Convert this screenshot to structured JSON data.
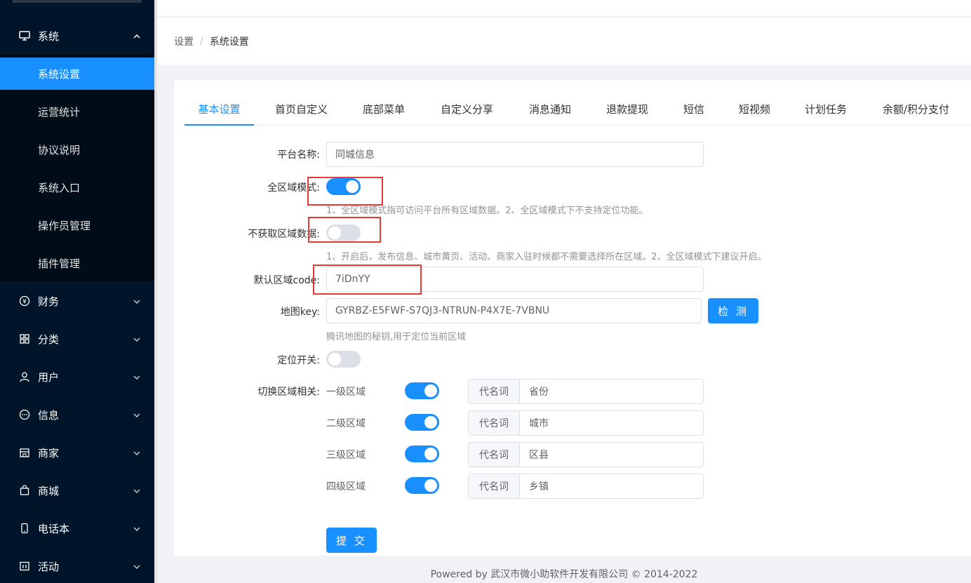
{
  "sidebar": {
    "system": {
      "label": "系统",
      "icon": "monitor-icon",
      "expanded": true
    },
    "sub_items": [
      {
        "label": "系统设置",
        "active": true
      },
      {
        "label": "运营统计"
      },
      {
        "label": "协议说明"
      },
      {
        "label": "系统入口"
      },
      {
        "label": "操作员管理"
      },
      {
        "label": "插件管理"
      }
    ],
    "groups": [
      {
        "label": "财务",
        "icon": "yen-icon"
      },
      {
        "label": "分类",
        "icon": "grid-icon"
      },
      {
        "label": "用户",
        "icon": "user-icon"
      },
      {
        "label": "信息",
        "icon": "chat-icon"
      },
      {
        "label": "商家",
        "icon": "store-icon"
      },
      {
        "label": "商城",
        "icon": "bag-icon"
      },
      {
        "label": "电话本",
        "icon": "phone-icon"
      },
      {
        "label": "活动",
        "icon": "calendar-icon"
      }
    ]
  },
  "breadcrumb": {
    "root": "设置",
    "separator": "/",
    "current": "系统设置"
  },
  "tabs": [
    {
      "label": "基本设置",
      "active": true
    },
    {
      "label": "首页自定义"
    },
    {
      "label": "底部菜单"
    },
    {
      "label": "自定义分享"
    },
    {
      "label": "消息通知"
    },
    {
      "label": "退款提现"
    },
    {
      "label": "短信"
    },
    {
      "label": "短视频"
    },
    {
      "label": "计划任务"
    },
    {
      "label": "余额/积分支付"
    }
  ],
  "form": {
    "platform_name": {
      "label": "平台名称:",
      "value": "同城信息"
    },
    "full_region": {
      "label": "全区域模式:",
      "on": true,
      "hint": "1、全区域模式指可访问平台所有区域数据。2、全区域模式下不支持定位功能。"
    },
    "no_region_data": {
      "label": "不获取区域数据:",
      "on": false,
      "hint": "1、开启后，发布信息、城市黄页、活动、商家入驻时候都不需要选择所在区域。2、全区域模式下建议开启。"
    },
    "default_region_code": {
      "label": "默认区域code:",
      "value": "7iDnYY"
    },
    "map_key": {
      "label": "地图key:",
      "value": "GYRBZ-E5FWF-S7QJ3-NTRUN-P4X7E-7VBNU",
      "button": "检 测",
      "hint": "腾讯地图的秘钥,用于定位当前区域"
    },
    "locate": {
      "label": "定位开关:",
      "on": false
    },
    "switch_region": {
      "label": "切换区域相关:",
      "alias_prefix": "代名词",
      "levels": [
        {
          "label": "一级区域",
          "on": true,
          "alias": "省份"
        },
        {
          "label": "二级区域",
          "on": true,
          "alias": "城市"
        },
        {
          "label": "三级区域",
          "on": true,
          "alias": "区县"
        },
        {
          "label": "四级区域",
          "on": true,
          "alias": "乡镇"
        }
      ]
    },
    "submit": "提 交"
  },
  "footer": "Powered by 武汉市微小助软件开发有限公司 © 2014-2022",
  "colors": {
    "primary": "#1890ff",
    "sidebar": "#001529",
    "highlight_box": "#e53935"
  }
}
